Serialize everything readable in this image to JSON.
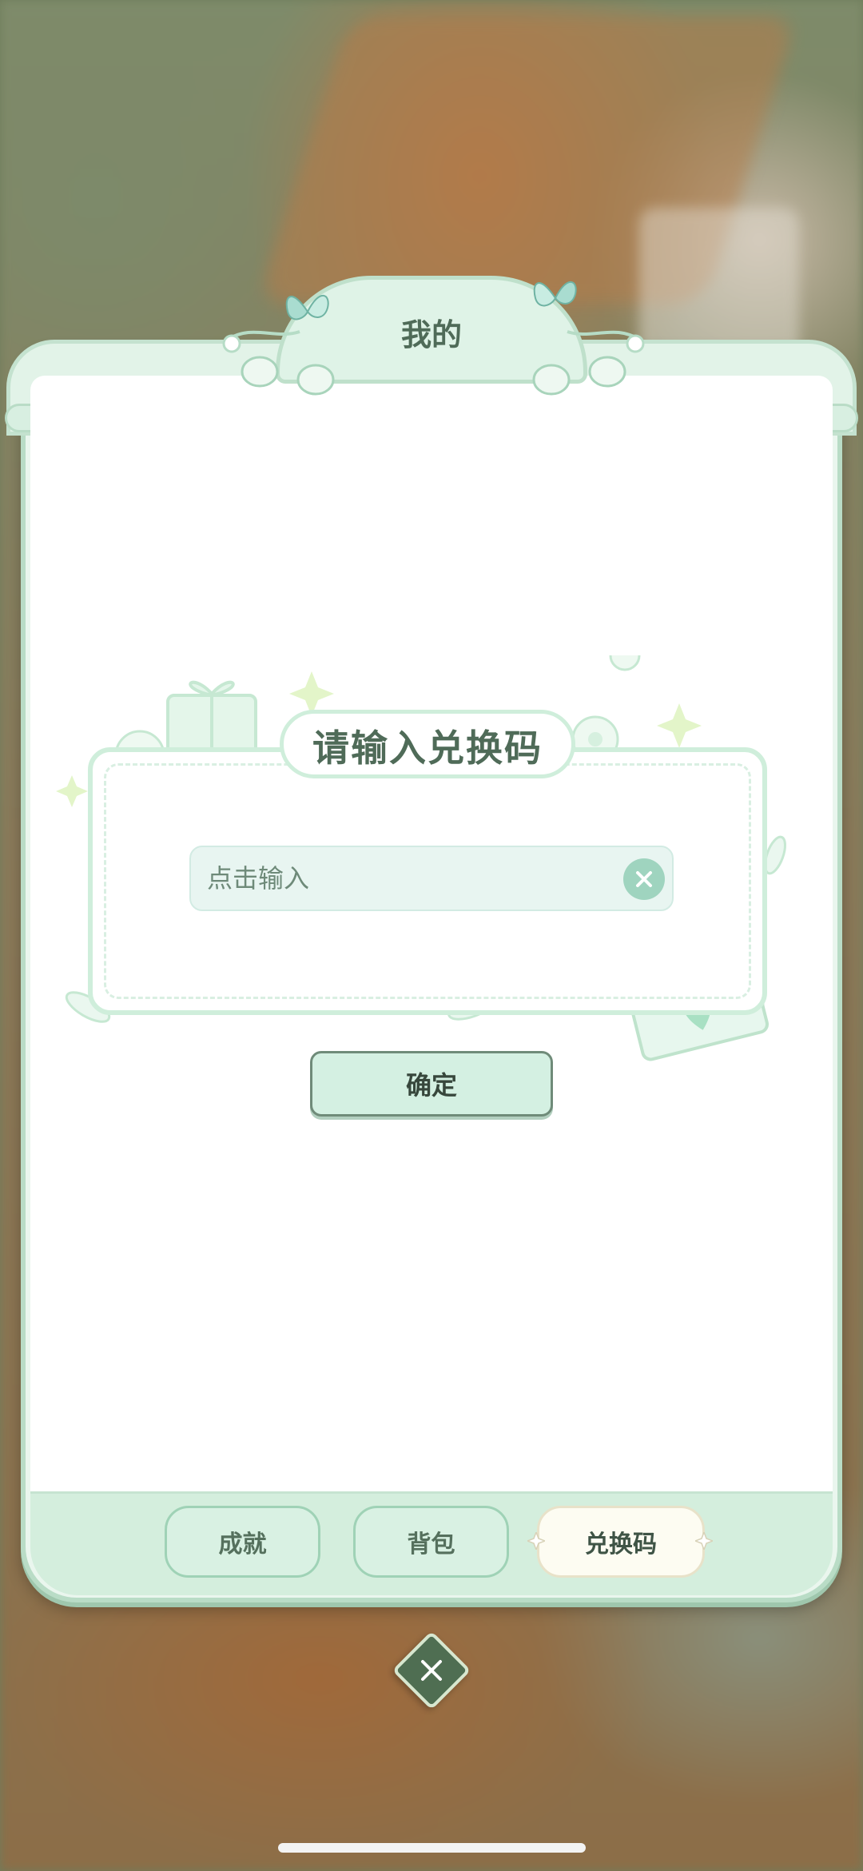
{
  "window": {
    "title": "我的"
  },
  "redeem": {
    "heading": "请输入兑换码",
    "input_placeholder": "点击输入",
    "input_value": "",
    "clear_icon": "clear-icon",
    "confirm_label": "确定"
  },
  "tabs": [
    {
      "label": "成就",
      "active": false
    },
    {
      "label": "背包",
      "active": false
    },
    {
      "label": "兑换码",
      "active": true
    }
  ],
  "close": {
    "icon": "close-icon"
  },
  "colors": {
    "accent": "#cfeedb",
    "text_primary": "#4f6b58",
    "button_border": "#6f8b79",
    "close_bg": "#4f6e52"
  }
}
